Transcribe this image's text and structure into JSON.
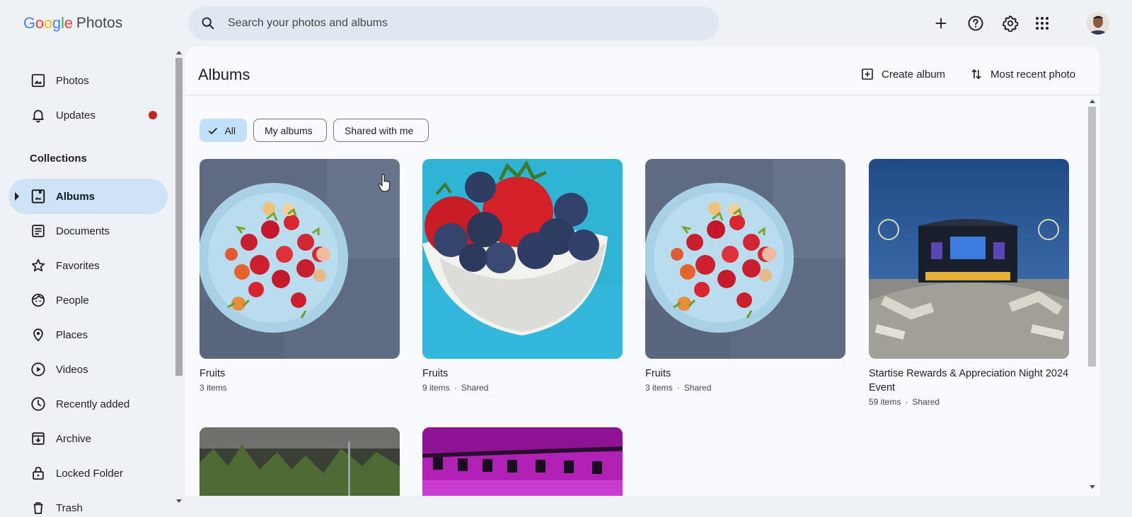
{
  "app": {
    "logo_letters": [
      "G",
      "o",
      "o",
      "g",
      "l",
      "e"
    ],
    "logo_colors": [
      "#4285f4",
      "#ea4335",
      "#fbbc05",
      "#4285f4",
      "#34a853",
      "#ea4335"
    ],
    "product": "Photos"
  },
  "search": {
    "placeholder": "Search your photos and albums",
    "value": ""
  },
  "header_icons": [
    "add-icon",
    "help-icon",
    "settings-icon",
    "apps-icon",
    "avatar"
  ],
  "sidebar": {
    "items": [
      {
        "label": "Photos",
        "icon": "photo-icon"
      },
      {
        "label": "Updates",
        "icon": "bell-icon",
        "badge_color": "#c5221f"
      },
      {
        "label": "Albums",
        "icon": "album-icon",
        "active": true
      },
      {
        "label": "Documents",
        "icon": "document-icon"
      },
      {
        "label": "Favorites",
        "icon": "star-icon"
      },
      {
        "label": "People",
        "icon": "face-icon"
      },
      {
        "label": "Places",
        "icon": "pin-icon"
      },
      {
        "label": "Videos",
        "icon": "play-icon"
      },
      {
        "label": "Recently added",
        "icon": "clock-icon"
      },
      {
        "label": "Archive",
        "icon": "archive-icon"
      },
      {
        "label": "Locked Folder",
        "icon": "lock-icon"
      },
      {
        "label": "Trash",
        "icon": "trash-icon"
      }
    ],
    "section_label": "Collections"
  },
  "main": {
    "title": "Albums",
    "create_album": "Create album",
    "sort": "Most recent photo",
    "filters": [
      "All",
      "My albums",
      "Shared with me"
    ],
    "selected_filter": "All",
    "albums": [
      {
        "title": "Fruits",
        "count": "3 items",
        "shared": ""
      },
      {
        "title": "Fruits",
        "count": "9 items",
        "shared": "Shared"
      },
      {
        "title": "Fruits",
        "count": "3 items",
        "shared": "Shared"
      },
      {
        "title": "Startise Rewards & Appreciation Night 2024 Event",
        "count": "59 items",
        "shared": "Shared"
      }
    ],
    "separator": "·"
  },
  "colors": {
    "accent_chip": "#c2e0fa",
    "active_nav": "#cfe3f7",
    "badge": "#c5221f"
  }
}
